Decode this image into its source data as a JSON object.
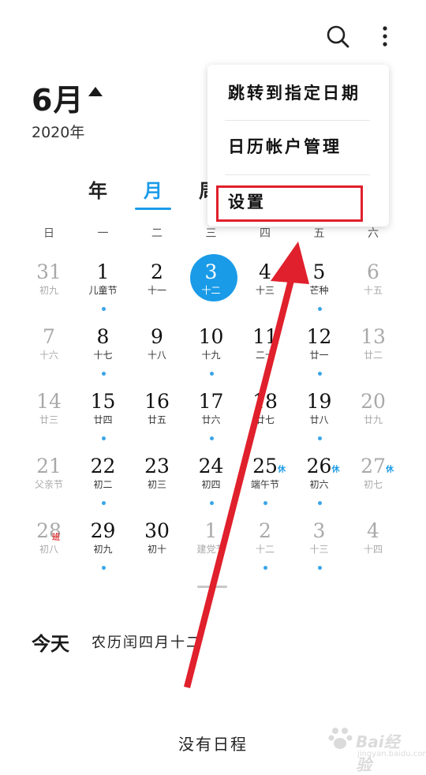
{
  "header": {
    "month": "6月",
    "year": "2020年",
    "icons": [
      "search-icon",
      "more-vertical-icon"
    ]
  },
  "tabs": [
    {
      "label": "年",
      "active": false
    },
    {
      "label": "月",
      "active": true
    },
    {
      "label": "周",
      "active": false
    }
  ],
  "weekdays": [
    "日",
    "一",
    "二",
    "三",
    "四",
    "五",
    "六"
  ],
  "calendar": {
    "rows": [
      [
        {
          "day": "31",
          "lunar": "初九",
          "other": true
        },
        {
          "day": "1",
          "lunar": "儿童节",
          "dot": true
        },
        {
          "day": "2",
          "lunar": "十一"
        },
        {
          "day": "3",
          "lunar": "十二",
          "today": true
        },
        {
          "day": "4",
          "lunar": "十三"
        },
        {
          "day": "5",
          "lunar": "芒种",
          "dot": true
        },
        {
          "day": "6",
          "lunar": "十五",
          "other": true
        }
      ],
      [
        {
          "day": "7",
          "lunar": "十六",
          "other": true
        },
        {
          "day": "8",
          "lunar": "十七",
          "dot": true
        },
        {
          "day": "9",
          "lunar": "十八"
        },
        {
          "day": "10",
          "lunar": "十九",
          "dot": true
        },
        {
          "day": "11",
          "lunar": "二十"
        },
        {
          "day": "12",
          "lunar": "廿一",
          "dot": true
        },
        {
          "day": "13",
          "lunar": "廿二",
          "other": true
        }
      ],
      [
        {
          "day": "14",
          "lunar": "廿三",
          "other": true
        },
        {
          "day": "15",
          "lunar": "廿四",
          "dot": true
        },
        {
          "day": "16",
          "lunar": "廿五"
        },
        {
          "day": "17",
          "lunar": "廿六",
          "dot": true
        },
        {
          "day": "18",
          "lunar": "廿七"
        },
        {
          "day": "19",
          "lunar": "廿八",
          "dot": true
        },
        {
          "day": "20",
          "lunar": "廿九",
          "other": true
        }
      ],
      [
        {
          "day": "21",
          "lunar": "父亲节",
          "other": true
        },
        {
          "day": "22",
          "lunar": "初二",
          "dot": true
        },
        {
          "day": "23",
          "lunar": "初三"
        },
        {
          "day": "24",
          "lunar": "初四",
          "dot": true
        },
        {
          "day": "25",
          "lunar": "端午节",
          "tag": "休",
          "dot": true
        },
        {
          "day": "26",
          "lunar": "初六",
          "tag": "休",
          "dot": true
        },
        {
          "day": "27",
          "lunar": "初七",
          "tag": "休",
          "other": true
        }
      ],
      [
        {
          "day": "28",
          "lunar": "初八",
          "tag_red": "班",
          "other": true
        },
        {
          "day": "29",
          "lunar": "初九",
          "dot": true
        },
        {
          "day": "30",
          "lunar": "初十"
        },
        {
          "day": "1",
          "lunar": "建党节",
          "other": true
        },
        {
          "day": "2",
          "lunar": "十二",
          "other": true,
          "dot": true
        },
        {
          "day": "3",
          "lunar": "十三",
          "other": true,
          "dot": true
        },
        {
          "day": "4",
          "lunar": "十四",
          "other": true
        }
      ]
    ]
  },
  "today": {
    "label": "今天",
    "lunar": "农历闰四月十二"
  },
  "no_schedule": "没有日程",
  "menu": {
    "items": [
      "跳转到指定日期",
      "日历帐户管理",
      "设置"
    ],
    "highlighted": "设置"
  },
  "watermark": {
    "text": "Bai经验",
    "sub": "jingyan.baidu.com"
  },
  "colors": {
    "accent": "#1a9be8",
    "annotation": "#e0202c"
  }
}
